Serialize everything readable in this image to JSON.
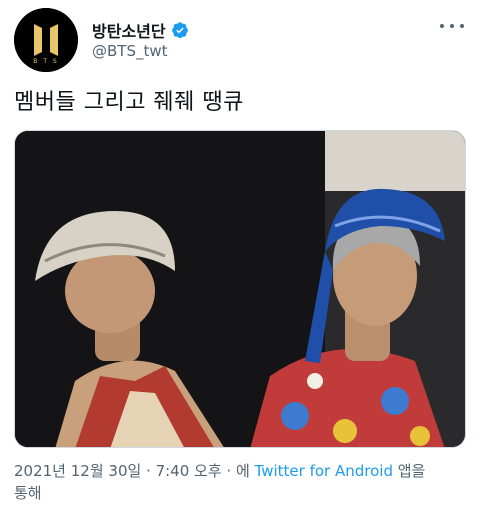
{
  "author": {
    "display_name": "방탄소년단",
    "handle": "@BTS_twt",
    "verified": true,
    "avatar_logo_text": "BTS"
  },
  "more_icon": "more-horizontal-icon",
  "tweet": {
    "text": "멤버들 그리고 줴줴 땡큐"
  },
  "photo": {
    "description_icon": "photo"
  },
  "meta": {
    "datetime": "2021년 12월 30일 · 7:40 오후 · ",
    "via_prefix": "에 ",
    "source": "Twitter for Android",
    "via_suffix": " 앱을",
    "line2": "통해"
  },
  "colors": {
    "accent": "#1d9bf0",
    "text": "#0f1419",
    "muted": "#536471",
    "logo_gold": "#e7c76b"
  }
}
